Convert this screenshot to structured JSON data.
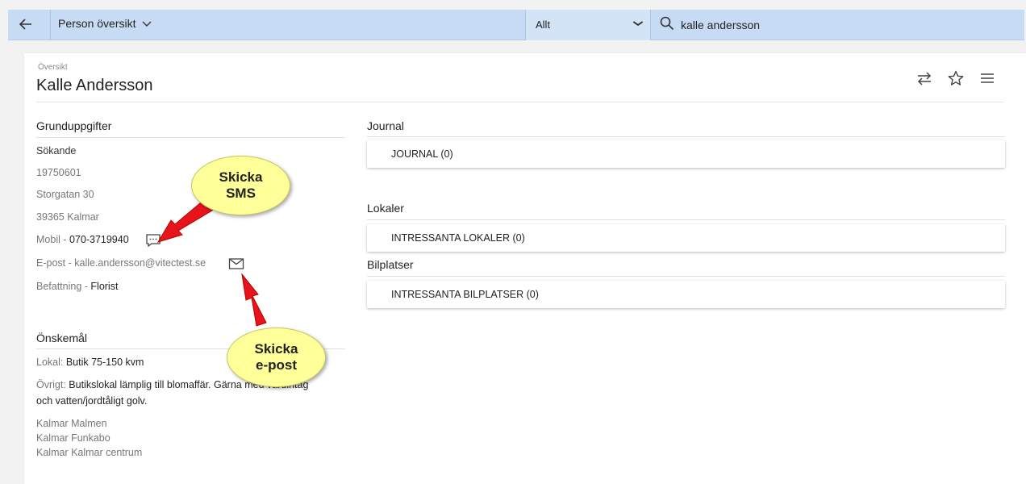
{
  "topbar": {
    "back_icon": "arrow-left-icon",
    "title": "Person översikt",
    "scope_value": "Allt",
    "search_value": "kalle andersson"
  },
  "header": {
    "breadcrumb": "Översikt",
    "name": "Kalle Andersson",
    "icons": [
      "swap-icon",
      "star-icon",
      "menu-icon"
    ]
  },
  "grunduppgifter": {
    "title": "Grunduppgifter",
    "role": "Sökande",
    "birthdate": "19750601",
    "street": "Storgatan 30",
    "city": "39365 Kalmar",
    "mobile_label": "Mobil - ",
    "mobile_value": "070-3719940",
    "email_label": "E-post - ",
    "email_value": "kalle.andersson@vitectest.se",
    "title_label": "Befattning - ",
    "title_value": "Florist"
  },
  "onskemal": {
    "title": "Önskemål",
    "lokal_label": "Lokal: ",
    "lokal_value": "Butik 75-150 kvm",
    "ovrigt_label": "Övrigt: ",
    "ovrigt_value_line1": "Butikslokal lämplig till blomaffär. Gärna med varuintag",
    "ovrigt_value_line2": "och vatten/jordtåligt golv.",
    "areas": [
      "Kalmar Malmen",
      "Kalmar Funkabo",
      "Kalmar Kalmar centrum"
    ]
  },
  "journal": {
    "title": "Journal",
    "panel": "JOURNAL (0)"
  },
  "lokaler": {
    "title": "Lokaler",
    "panel": "INTRESSANTA LOKALER (0)"
  },
  "bilplatser": {
    "title": "Bilplatser",
    "panel": "INTRESSANTA BILPLATSER (0)"
  },
  "callouts": {
    "sms_line1": "Skicka",
    "sms_line2": "SMS",
    "email_line1": "Skicka",
    "email_line2": "e-post"
  },
  "colors": {
    "topbar": "#c7dcf4",
    "callout": "#ffff99",
    "arrow": "#e8141c"
  }
}
